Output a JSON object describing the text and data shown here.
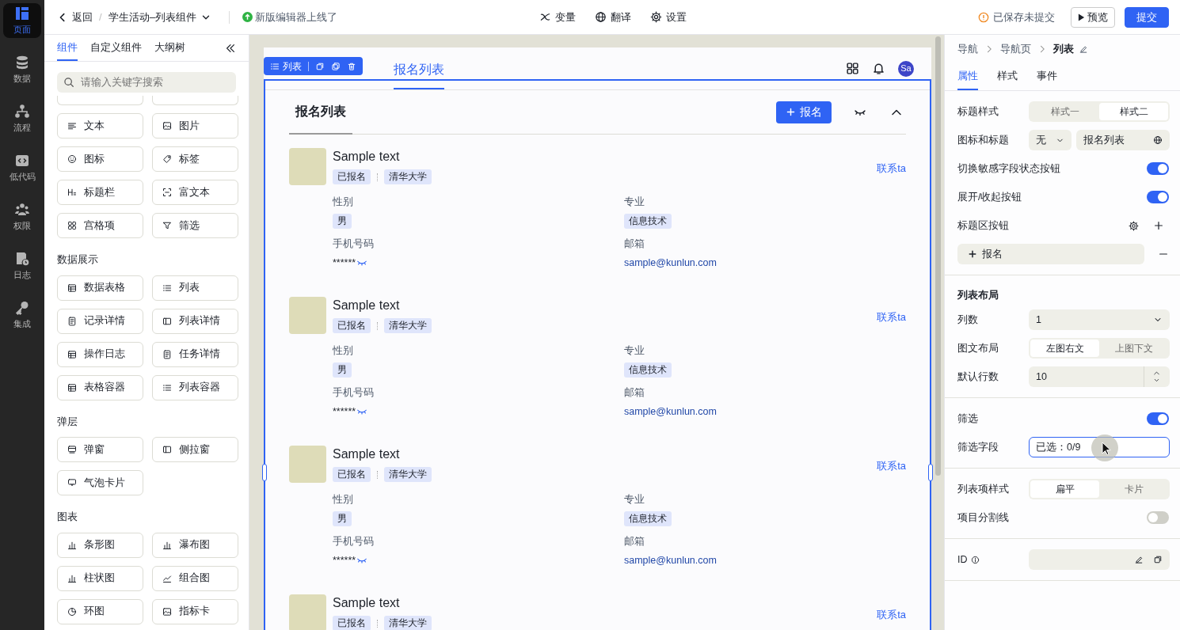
{
  "rail": [
    {
      "label": "页面",
      "selected": true
    },
    {
      "label": "数据",
      "selected": false
    },
    {
      "label": "流程",
      "selected": false
    },
    {
      "label": "低代码",
      "selected": false
    },
    {
      "label": "权限",
      "selected": false
    },
    {
      "label": "日志",
      "selected": false
    },
    {
      "label": "集成",
      "selected": false
    }
  ],
  "topbar": {
    "back": "返回",
    "separator": "/",
    "title": "学生活动–列表组件",
    "notice": "新版编辑器上线了",
    "tools": [
      "变量",
      "翻译",
      "设置"
    ],
    "save_status": "已保存未提交",
    "preview": "预览",
    "submit": "提交"
  },
  "left_panel": {
    "tabs": [
      {
        "label": "组件",
        "selected": true
      },
      {
        "label": "自定义组件",
        "selected": false
      },
      {
        "label": "大纲树",
        "selected": false
      }
    ],
    "search": {
      "placeholder": "请输入关键字搜索"
    },
    "groups": [
      {
        "items": [
          "文本",
          "图片",
          "图标",
          "标签",
          "标题栏",
          "富文本",
          "宫格项",
          "筛选"
        ]
      },
      {
        "title": "数据展示",
        "items": [
          "数据表格",
          "列表",
          "记录详情",
          "列表详情",
          "操作日志",
          "任务详情",
          "表格容器",
          "列表容器"
        ]
      },
      {
        "title": "弹层",
        "items": [
          "弹窗",
          "侧拉窗",
          "气泡卡片"
        ]
      },
      {
        "title": "图表",
        "items": [
          "条形图",
          "瀑布图",
          "柱状图",
          "组合图",
          "环图",
          "指标卡"
        ]
      }
    ]
  },
  "canvas": {
    "selection_label": "列表",
    "page_tab": "报名列表",
    "avatar": "Sa",
    "list": {
      "title": "报名列表",
      "add_button": "报名",
      "items": [
        {
          "title": "Sample text",
          "tags": [
            "已报名",
            "清华大学"
          ],
          "contact": "联系ta",
          "fields": [
            {
              "label": "性别",
              "value": "男",
              "kind": "tag"
            },
            {
              "label": "专业",
              "value": "信息技术",
              "kind": "tag"
            },
            {
              "label": "手机号码",
              "value": "******",
              "kind": "masked"
            },
            {
              "label": "邮箱",
              "value": "sample@kunlun.com",
              "kind": "link"
            }
          ]
        },
        {
          "title": "Sample text",
          "tags": [
            "已报名",
            "清华大学"
          ],
          "contact": "联系ta",
          "fields": [
            {
              "label": "性别",
              "value": "男",
              "kind": "tag"
            },
            {
              "label": "专业",
              "value": "信息技术",
              "kind": "tag"
            },
            {
              "label": "手机号码",
              "value": "******",
              "kind": "masked"
            },
            {
              "label": "邮箱",
              "value": "sample@kunlun.com",
              "kind": "link"
            }
          ]
        },
        {
          "title": "Sample text",
          "tags": [
            "已报名",
            "清华大学"
          ],
          "contact": "联系ta",
          "fields": [
            {
              "label": "性别",
              "value": "男",
              "kind": "tag"
            },
            {
              "label": "专业",
              "value": "信息技术",
              "kind": "tag"
            },
            {
              "label": "手机号码",
              "value": "******",
              "kind": "masked"
            },
            {
              "label": "邮箱",
              "value": "sample@kunlun.com",
              "kind": "link"
            }
          ]
        },
        {
          "title": "Sample text",
          "tags": [
            "已报名",
            "清华大学"
          ],
          "contact": "联系ta"
        }
      ]
    }
  },
  "right_panel": {
    "breadcrumb": [
      "导航",
      "导航页",
      "列表"
    ],
    "tabs": [
      {
        "label": "属性",
        "selected": true
      },
      {
        "label": "样式",
        "selected": false
      },
      {
        "label": "事件",
        "selected": false
      }
    ],
    "sections": [
      {
        "rows": [
          {
            "kind": "segmented",
            "label": "标题样式",
            "options": [
              {
                "label": "样式一",
                "selected": false
              },
              {
                "label": "样式二",
                "selected": true
              }
            ]
          },
          {
            "kind": "icon_title",
            "label": "图标和标题",
            "select": "无",
            "value": "报名列表"
          },
          {
            "kind": "toggle",
            "label": "切换敏感字段状态按钮",
            "on": true
          },
          {
            "kind": "toggle",
            "label": "展开/收起按钮",
            "on": true
          },
          {
            "kind": "actions",
            "label": "标题区按钮"
          },
          {
            "kind": "button_item",
            "label": "报名"
          }
        ]
      },
      {
        "title": "列表布局",
        "rows": [
          {
            "kind": "select",
            "label": "列数",
            "value": "1"
          },
          {
            "kind": "segmented",
            "label": "图文布局",
            "options": [
              {
                "label": "左图右文",
                "selected": true
              },
              {
                "label": "上图下文",
                "selected": false
              }
            ]
          },
          {
            "kind": "number",
            "label": "默认行数",
            "value": "10"
          }
        ]
      },
      {
        "rows": [
          {
            "kind": "toggle",
            "label": "筛选",
            "on": true
          },
          {
            "kind": "picker",
            "label": "筛选字段",
            "value": "已选：0/9",
            "focused": true
          }
        ]
      },
      {
        "rows": [
          {
            "kind": "segmented",
            "label": "列表项样式",
            "options": [
              {
                "label": "扁平",
                "selected": true
              },
              {
                "label": "卡片",
                "selected": false
              }
            ]
          },
          {
            "kind": "toggle",
            "label": "项目分割线",
            "on": false
          }
        ]
      },
      {
        "rows": [
          {
            "kind": "id",
            "label": "ID"
          }
        ]
      }
    ]
  }
}
